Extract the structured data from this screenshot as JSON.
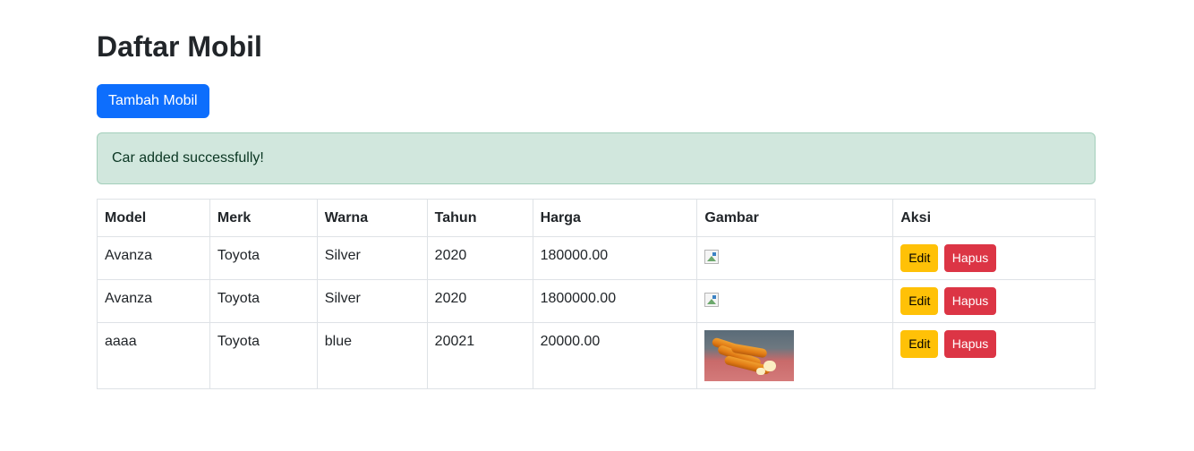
{
  "page": {
    "title": "Daftar Mobil",
    "add_button_label": "Tambah Mobil",
    "alert_message": "Car added successfully!"
  },
  "colors": {
    "primary": "#0d6efd",
    "success_bg": "#d1e7dd",
    "warning": "#ffc107",
    "danger": "#dc3545"
  },
  "table": {
    "headers": [
      "Model",
      "Merk",
      "Warna",
      "Tahun",
      "Harga",
      "Gambar",
      "Aksi"
    ],
    "rows": [
      {
        "model": "Avanza",
        "merk": "Toyota",
        "warna": "Silver",
        "tahun": "2020",
        "harga": "180000.00",
        "gambar": "broken-image-icon",
        "edit_label": "Edit",
        "delete_label": "Hapus"
      },
      {
        "model": "Avanza",
        "merk": "Toyota",
        "warna": "Silver",
        "tahun": "2020",
        "harga": "1800000.00",
        "gambar": "broken-image-icon",
        "edit_label": "Edit",
        "delete_label": "Hapus"
      },
      {
        "model": "aaaa",
        "merk": "Toyota",
        "warna": "blue",
        "tahun": "20021",
        "harga": "20000.00",
        "gambar": "food-photo",
        "edit_label": "Edit",
        "delete_label": "Hapus"
      }
    ]
  }
}
